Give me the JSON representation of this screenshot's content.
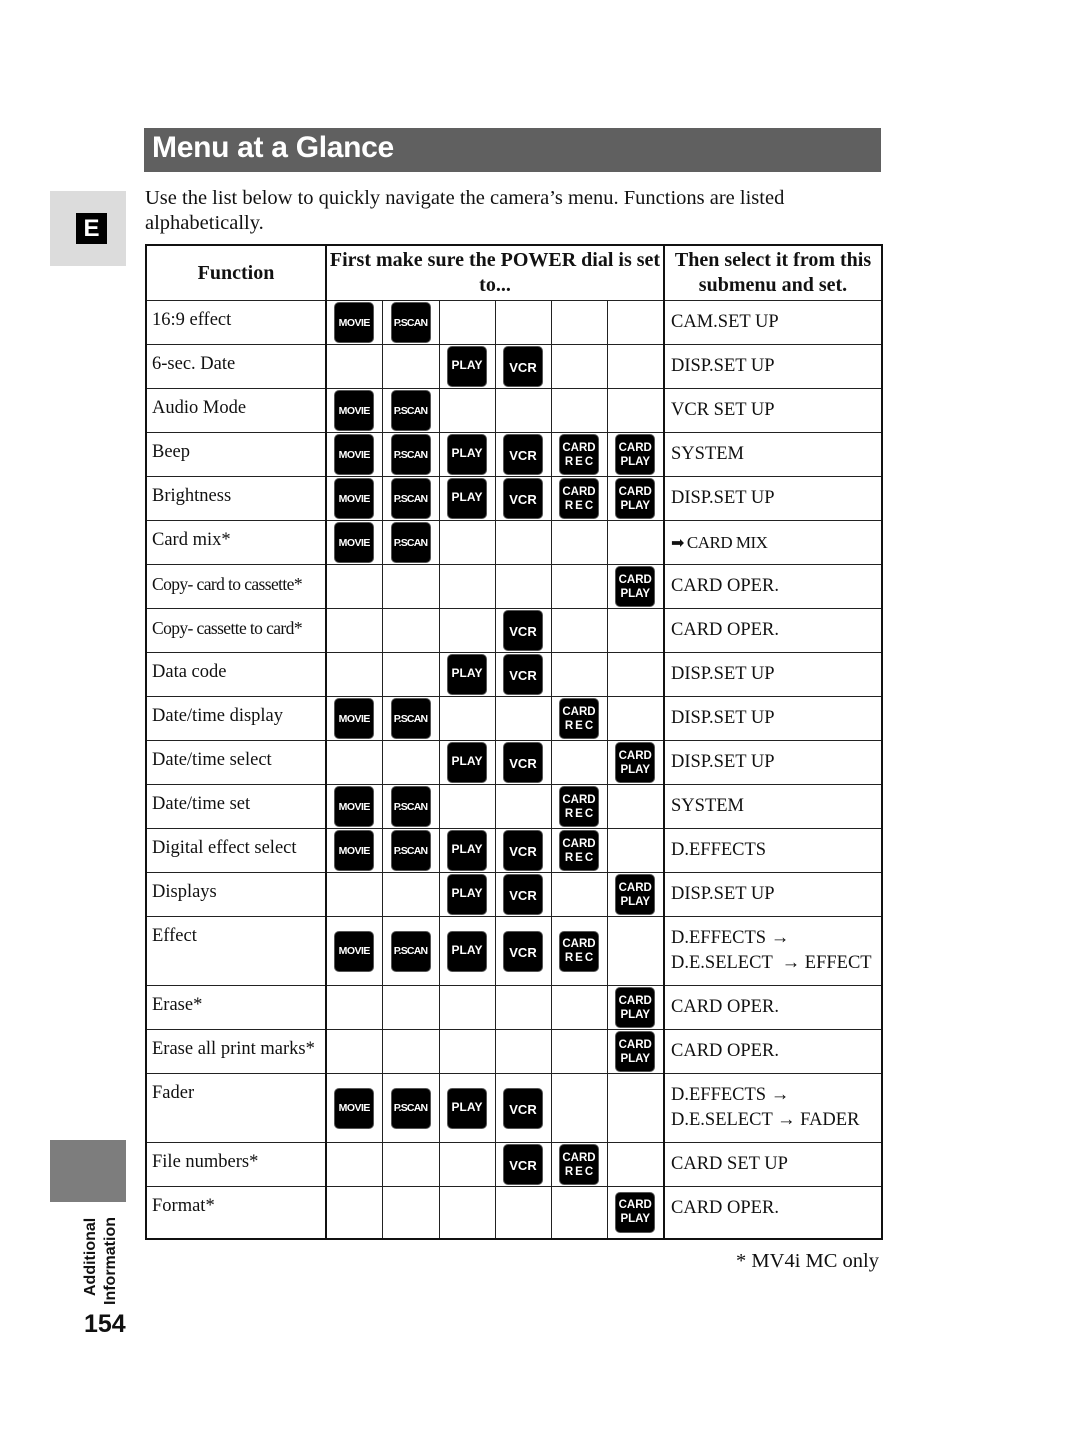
{
  "page": {
    "title": "Menu at a Glance",
    "intro": "Use the list below to quickly navigate the camera’s menu. Functions are listed alphabetically.",
    "language_tab": "E",
    "section_label_line1": "Additional",
    "section_label_line2": "Information",
    "page_number": "154",
    "footnote": "* MV4i MC only"
  },
  "table": {
    "headers": {
      "function": "Function",
      "power_dial": "First make sure the POWER dial is set to...",
      "submenu": "Then select it from this submenu and set."
    },
    "modes": [
      {
        "id": "movie",
        "label": "MOVIE"
      },
      {
        "id": "pscan",
        "label": "P.SCAN"
      },
      {
        "id": "play",
        "label": "PLAY"
      },
      {
        "id": "vcr",
        "label": "VCR"
      },
      {
        "id": "cardrec",
        "label1": "CARD",
        "label2": "REC"
      },
      {
        "id": "cardplay",
        "label1": "CARD",
        "label2": "PLAY"
      }
    ],
    "rows": [
      {
        "function": "16:9 effect",
        "modes": [
          1,
          1,
          0,
          0,
          0,
          0
        ],
        "submenu": "CAM.SET UP"
      },
      {
        "function": "6-sec. Date",
        "modes": [
          0,
          0,
          1,
          1,
          0,
          0
        ],
        "submenu": "DISP.SET UP"
      },
      {
        "function": "Audio Mode",
        "modes": [
          1,
          1,
          0,
          0,
          0,
          0
        ],
        "submenu": "VCR SET UP"
      },
      {
        "function": "Beep",
        "modes": [
          1,
          1,
          1,
          1,
          1,
          1
        ],
        "submenu": "SYSTEM"
      },
      {
        "function": "Brightness",
        "modes": [
          1,
          1,
          1,
          1,
          1,
          1
        ],
        "submenu": "DISP.SET UP"
      },
      {
        "function": "Card mix*",
        "modes": [
          1,
          1,
          0,
          0,
          0,
          0
        ],
        "submenu": "CARD MIX",
        "submenu_icon": "arrow-right-icon"
      },
      {
        "function": "Copy- card to cassette*",
        "modes": [
          0,
          0,
          0,
          0,
          0,
          1
        ],
        "submenu": "CARD OPER."
      },
      {
        "function": "Copy- cassette to card*",
        "modes": [
          0,
          0,
          0,
          1,
          0,
          0
        ],
        "submenu": "CARD OPER."
      },
      {
        "function": "Data code",
        "modes": [
          0,
          0,
          1,
          1,
          0,
          0
        ],
        "submenu": "DISP.SET UP"
      },
      {
        "function": "Date/time display",
        "modes": [
          1,
          1,
          0,
          0,
          1,
          0
        ],
        "submenu": "DISP.SET UP"
      },
      {
        "function": "Date/time select",
        "modes": [
          0,
          0,
          1,
          1,
          0,
          1
        ],
        "submenu": "DISP.SET UP"
      },
      {
        "function": "Date/time set",
        "modes": [
          1,
          1,
          0,
          0,
          1,
          0
        ],
        "submenu": "SYSTEM"
      },
      {
        "function": "Digital effect select",
        "modes": [
          1,
          1,
          1,
          1,
          1,
          0
        ],
        "submenu": "D.EFFECTS"
      },
      {
        "function": "Displays",
        "modes": [
          0,
          0,
          1,
          1,
          0,
          1
        ],
        "submenu": "DISP.SET UP"
      },
      {
        "function": "Effect",
        "modes": [
          1,
          1,
          1,
          1,
          1,
          0
        ],
        "submenu": "D.EFFECTS →",
        "submenu2": "D.E.SELECT  → EFFECT"
      },
      {
        "function": "Erase*",
        "modes": [
          0,
          0,
          0,
          0,
          0,
          1
        ],
        "submenu": "CARD OPER."
      },
      {
        "function": "Erase all print marks*",
        "modes": [
          0,
          0,
          0,
          0,
          0,
          1
        ],
        "submenu": "CARD OPER."
      },
      {
        "function": "Fader",
        "modes": [
          1,
          1,
          1,
          1,
          0,
          0
        ],
        "submenu": "D.EFFECTS →",
        "submenu2": "D.E.SELECT → FADER"
      },
      {
        "function": "File numbers*",
        "modes": [
          0,
          0,
          0,
          1,
          1,
          0
        ],
        "submenu": "CARD SET UP"
      },
      {
        "function": "Format*",
        "modes": [
          0,
          0,
          0,
          0,
          0,
          1
        ],
        "submenu": "CARD OPER."
      }
    ]
  }
}
